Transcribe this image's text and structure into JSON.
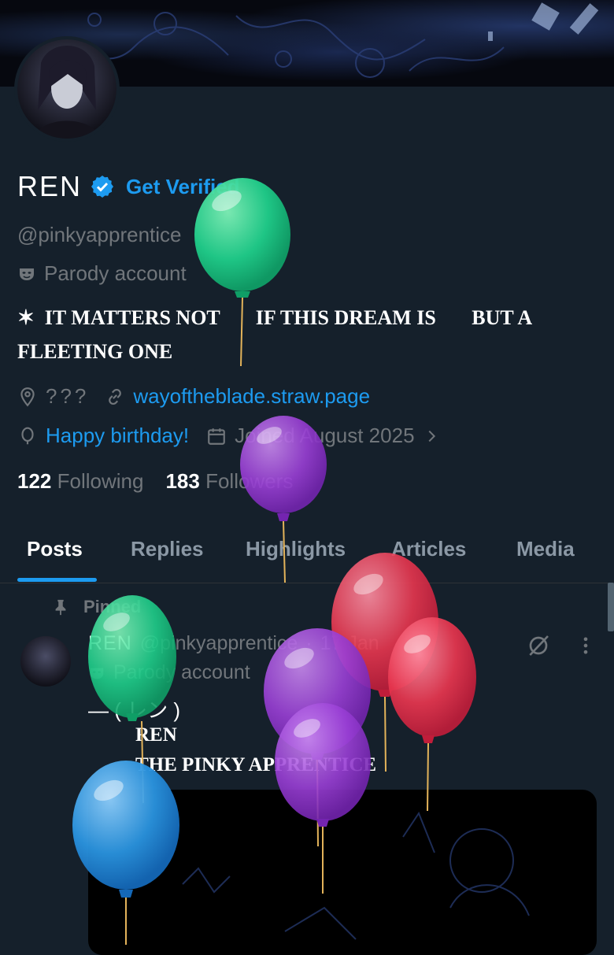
{
  "profile": {
    "name": "REN",
    "get_verified": "Get Verified",
    "handle": "@pinkyapprentice",
    "parody": "Parody account",
    "bio_line1": "✶  IT MATTERS NOT       IF THIS DREAM IS       BUT A",
    "bio_line2": "FLEETING ONE",
    "location": "???",
    "website": "wayoftheblade.straw.page",
    "birthday": "Happy birthday!",
    "joined": "Joined August 2025",
    "following_count": "122",
    "following_label": "Following",
    "followers_count": "183",
    "followers_label": "Followers"
  },
  "tabs": [
    "Posts",
    "Replies",
    "Highlights",
    "Articles",
    "Media"
  ],
  "post": {
    "pinned_label": "Pinned",
    "author_name": "REN",
    "author_handle": "@pinkyapprentice",
    "dot": "·",
    "date": "17 Jan",
    "parody": "Parody account",
    "line1": "— ( レン )",
    "line2": "REN",
    "line3": "THE PINKY APPRENTICE"
  },
  "colors": {
    "background": "#15202b",
    "accent": "#1d9bf0",
    "muted": "#71767b",
    "text": "#e7e9ea"
  },
  "icons": {
    "verified": "verified-badge-icon",
    "parody": "mask-icon",
    "location": "location-pin-icon",
    "link": "link-icon",
    "birthday": "balloon-icon",
    "calendar": "calendar-icon",
    "chevron": "chevron-right-icon",
    "pin": "pin-icon",
    "grok": "grok-icon",
    "more": "more-icon"
  },
  "decorations": {
    "balloons": [
      "green",
      "purple",
      "green",
      "red",
      "red",
      "purple",
      "purple",
      "blue"
    ]
  }
}
